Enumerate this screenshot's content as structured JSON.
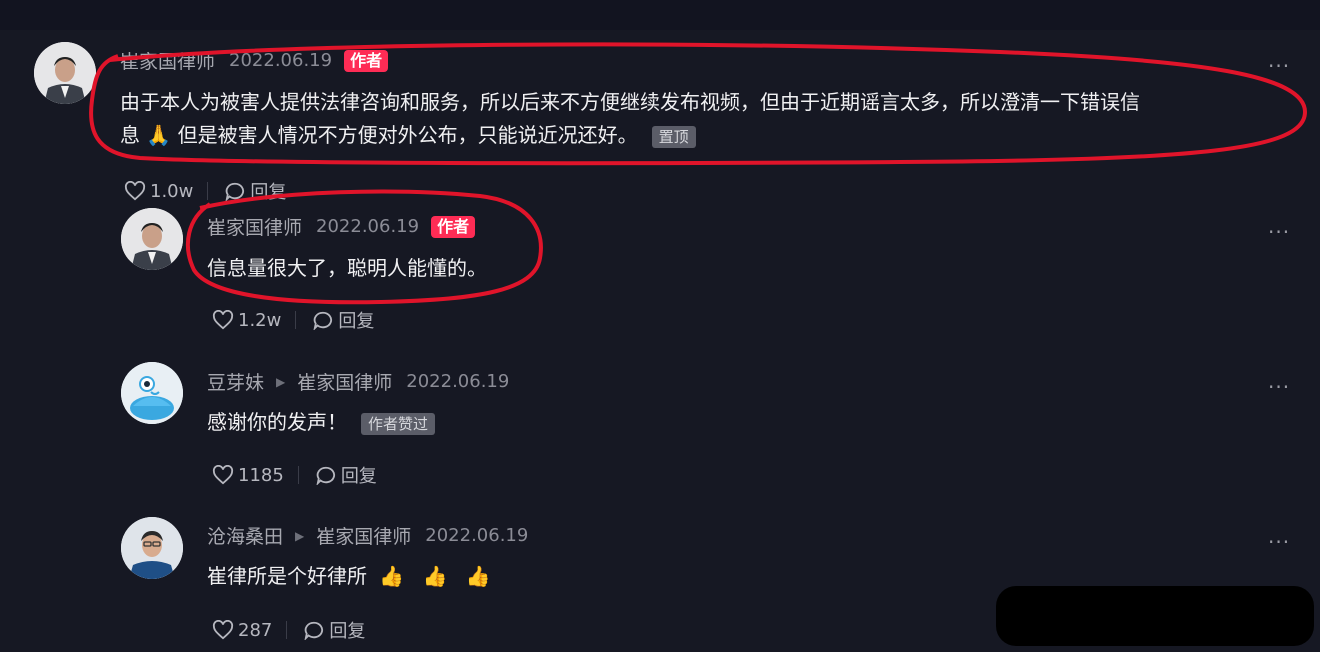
{
  "comments": [
    {
      "username": "崔家国律师",
      "date": "2022.06.19",
      "author_badge": "作者",
      "text_line1": "由于本人为被害人提供法律咨询和服务，所以后来不方便继续发布视频，但由于近期谣言太多，所以澄清一下错误信",
      "text_line2_a": "息",
      "emoji": "🙏",
      "text_line2_b": "但是被害人情况不方便对外公布，只能说近况还好。",
      "tag": "置顶",
      "likes": "1.0w",
      "reply_label": "回复",
      "more": "···"
    },
    {
      "username": "崔家国律师",
      "date": "2022.06.19",
      "author_badge": "作者",
      "text": "信息量很大了，聪明人能懂的。",
      "likes": "1.2w",
      "reply_label": "回复",
      "more": "···"
    },
    {
      "username": "豆芽妹",
      "reply_to": "崔家国律师",
      "date": "2022.06.19",
      "text": "感谢你的发声！",
      "tag": "作者赞过",
      "likes": "1185",
      "reply_label": "回复",
      "more": "···"
    },
    {
      "username": "沧海桑田",
      "reply_to": "崔家国律师",
      "date": "2022.06.19",
      "text": "崔律所是个好律所",
      "emojis": "👍 👍 👍",
      "likes": "287",
      "reply_label": "回复",
      "more": "···"
    }
  ],
  "colors": {
    "background": "#161823",
    "author_badge": "#fe2c55",
    "annotation_ring": "#e0142a",
    "redaction": "#000000"
  },
  "icons": [
    "heart-icon",
    "comment-bubble-icon",
    "play-triangle-icon",
    "more-dots-icon"
  ]
}
